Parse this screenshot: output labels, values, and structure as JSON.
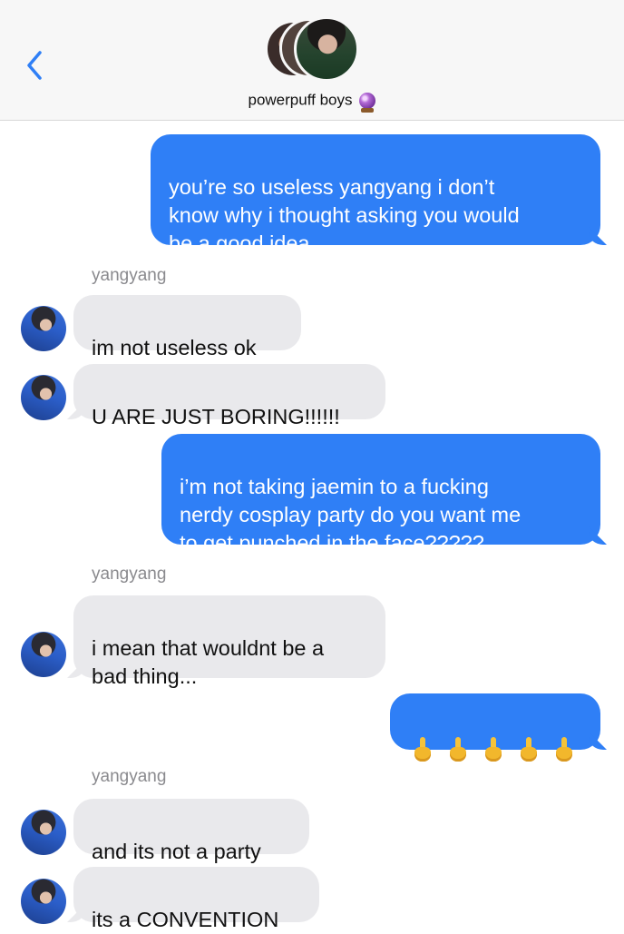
{
  "header": {
    "back_icon": "chevron-left-icon",
    "group_name": "powerpuff boys",
    "group_emoji": "crystal-ball-icon",
    "accent_color": "#2f7ff6"
  },
  "messages": [
    {
      "direction": "outgoing",
      "text": "you’re so useless yangyang i don’t\nknow why i thought asking you would\nbe a good idea"
    },
    {
      "direction": "incoming",
      "sender": "yangyang",
      "text": "im not useless ok"
    },
    {
      "direction": "incoming",
      "text": "U ARE JUST BORING!!!!!!"
    },
    {
      "direction": "outgoing",
      "text": "i’m not taking jaemin to a fucking\nnerdy cosplay party do you want me\nto get punched in the face?????"
    },
    {
      "direction": "incoming",
      "sender": "yangyang",
      "text": "i mean that wouldnt be a\nbad thing..."
    },
    {
      "direction": "outgoing",
      "emoji": "middle-finger-icon",
      "emoji_count": 5
    },
    {
      "direction": "incoming",
      "sender": "yangyang",
      "text": "and its not a party"
    },
    {
      "direction": "incoming",
      "text": "its a CONVENTION"
    }
  ]
}
